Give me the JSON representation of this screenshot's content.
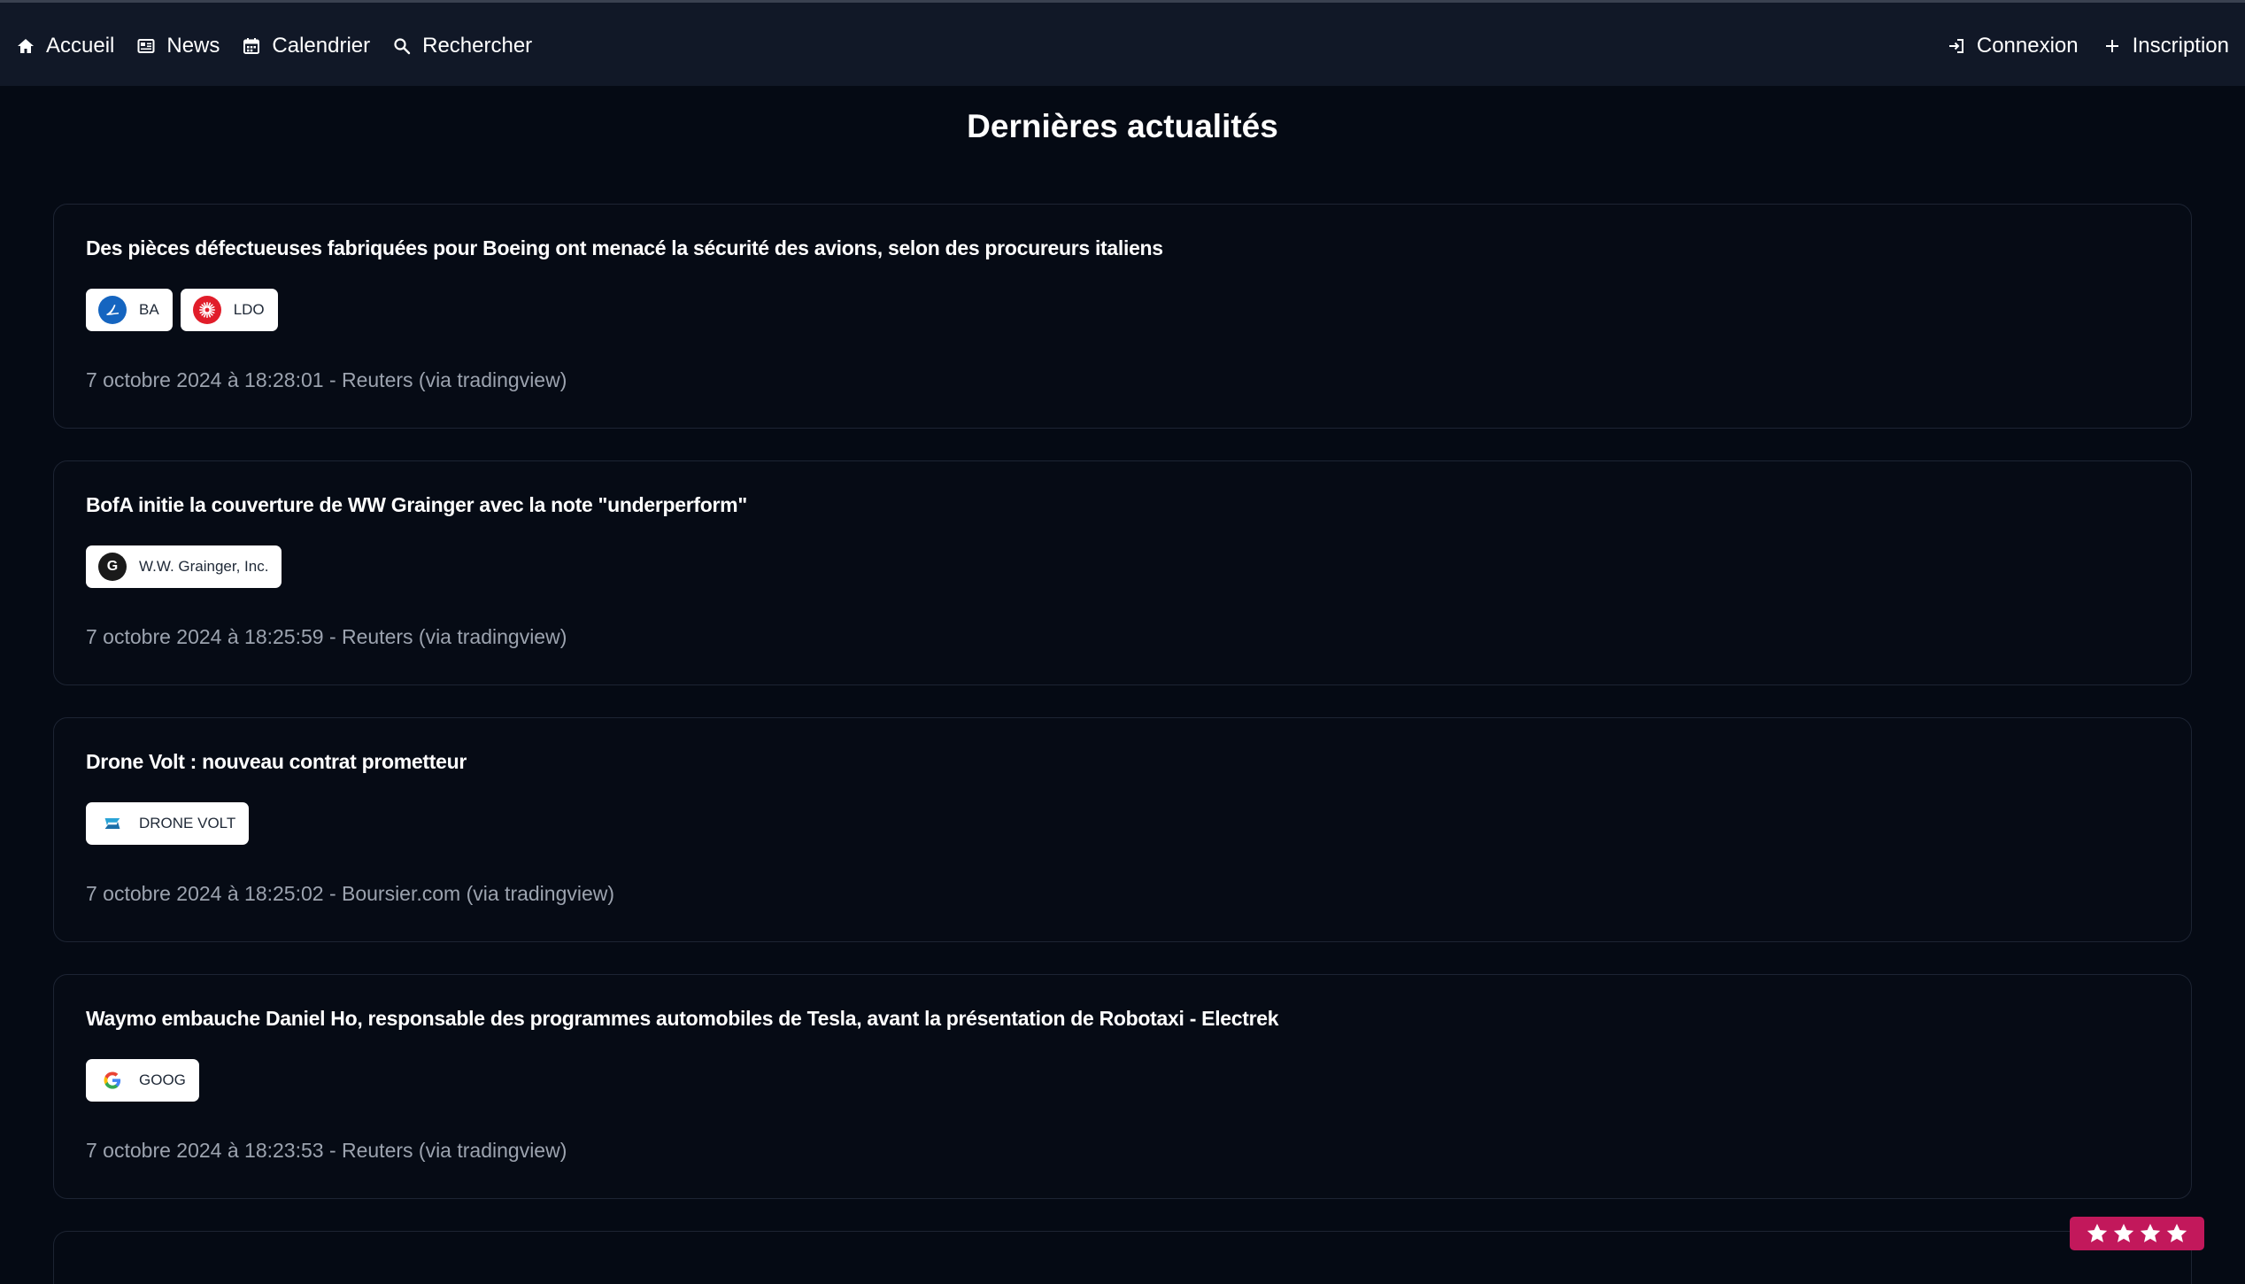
{
  "nav": {
    "left": [
      {
        "label": "Accueil",
        "icon": "home-icon"
      },
      {
        "label": "News",
        "icon": "newspaper-icon"
      },
      {
        "label": "Calendrier",
        "icon": "calendar-icon"
      },
      {
        "label": "Rechercher",
        "icon": "search-icon"
      }
    ],
    "right": [
      {
        "label": "Connexion",
        "icon": "login-icon"
      },
      {
        "label": "Inscription",
        "icon": "plus-icon"
      }
    ]
  },
  "page": {
    "title": "Dernières actualités"
  },
  "news": [
    {
      "title": "Des pièces défectueuses fabriquées pour Boeing ont menacé la sécurité des avions, selon des procureurs italiens",
      "tags": [
        {
          "label": "BA",
          "logo": "boeing-logo",
          "color": "#1565c0"
        },
        {
          "label": "LDO",
          "logo": "leonardo-logo",
          "color": "#e11d2a"
        }
      ],
      "meta": "7 octobre 2024 à 18:28:01 - Reuters (via tradingview)"
    },
    {
      "title": "BofA initie la couverture de WW Grainger avec la note \"underperform\"",
      "tags": [
        {
          "label": "W.W. Grainger, Inc.",
          "logo": "grainger-logo",
          "color": "#1a1a1a",
          "glyph": "G"
        }
      ],
      "meta": "7 octobre 2024 à 18:25:59 - Reuters (via tradingview)"
    },
    {
      "title": "Drone Volt : nouveau contrat prometteur",
      "tags": [
        {
          "label": "DRONE VOLT",
          "logo": "drone-volt-logo",
          "color": "#29a3d6"
        }
      ],
      "meta": "7 octobre 2024 à 18:25:02 - Boursier.com (via tradingview)"
    },
    {
      "title": "Waymo embauche Daniel Ho, responsable des programmes automobiles de Tesla, avant la présentation de Robotaxi - Electrek",
      "tags": [
        {
          "label": "GOOG",
          "logo": "google-logo",
          "color": "#4285f4"
        }
      ],
      "meta": "7 octobre 2024 à 18:23:53 - Reuters (via tradingview)"
    }
  ],
  "rating_badge": {
    "stars": 4,
    "color": "#c2185b"
  }
}
